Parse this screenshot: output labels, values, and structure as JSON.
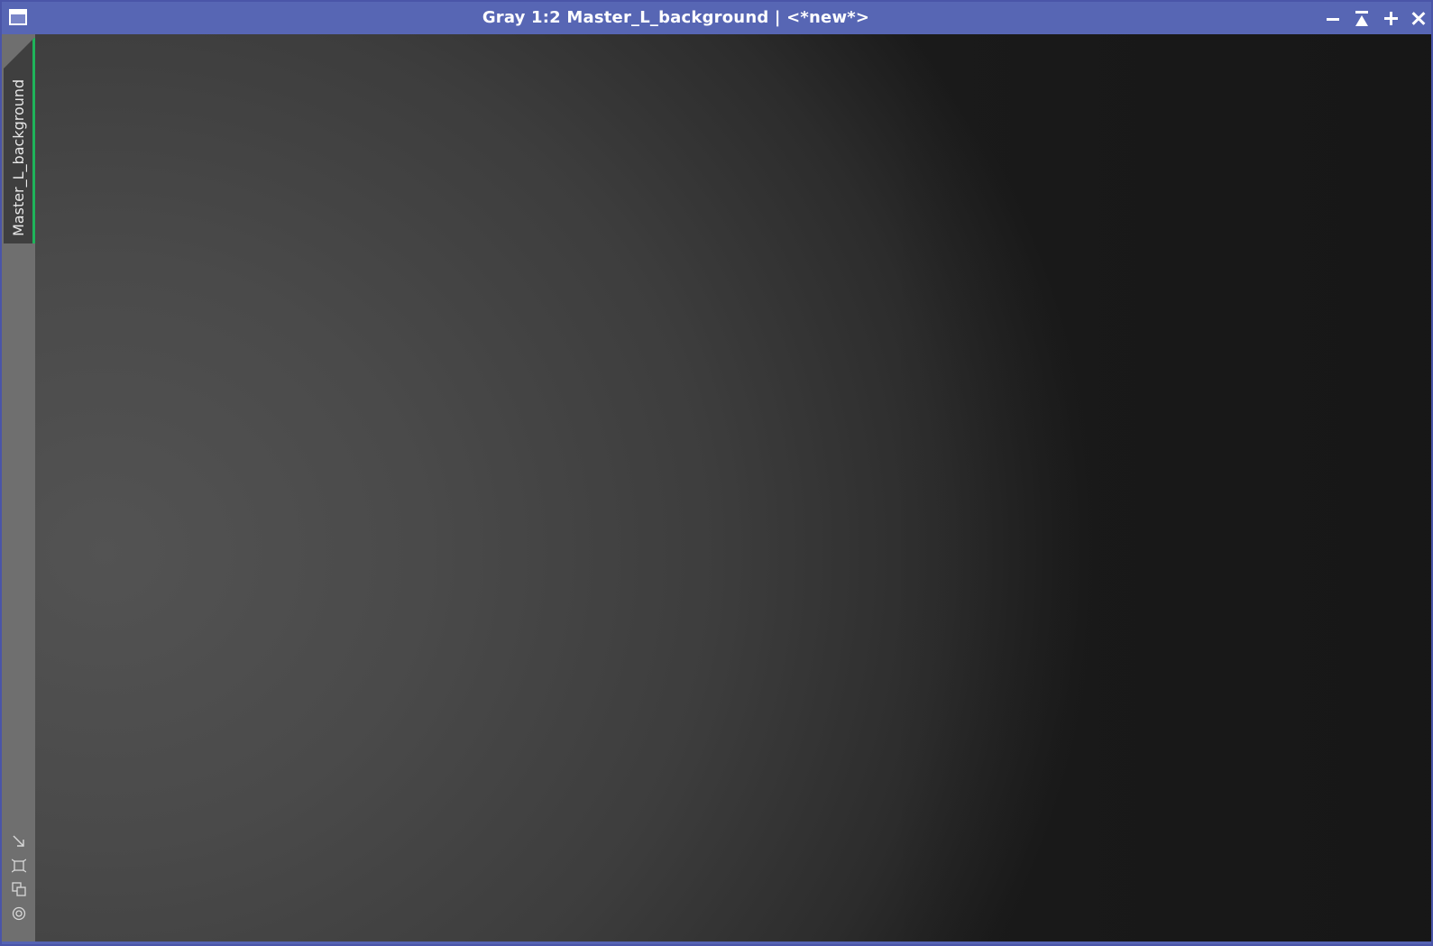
{
  "window": {
    "title": "Gray 1:2 Master_L_background | <*new*>",
    "titlebar_color": "#5766b4",
    "controls": [
      {
        "icon": "minimize-icon"
      },
      {
        "icon": "shade-icon"
      },
      {
        "icon": "maximize-icon"
      },
      {
        "icon": "close-icon"
      }
    ]
  },
  "side_panel": {
    "tab_label": "Master_L_background",
    "tab_accent_color": "#1fb45a",
    "tools": [
      {
        "icon": "fit-view-arrow-icon"
      },
      {
        "icon": "crop-frame-icon"
      },
      {
        "icon": "clone-window-icon"
      },
      {
        "icon": "target-circle-icon"
      }
    ]
  },
  "image_view": {
    "content": "gray gradient background model"
  }
}
